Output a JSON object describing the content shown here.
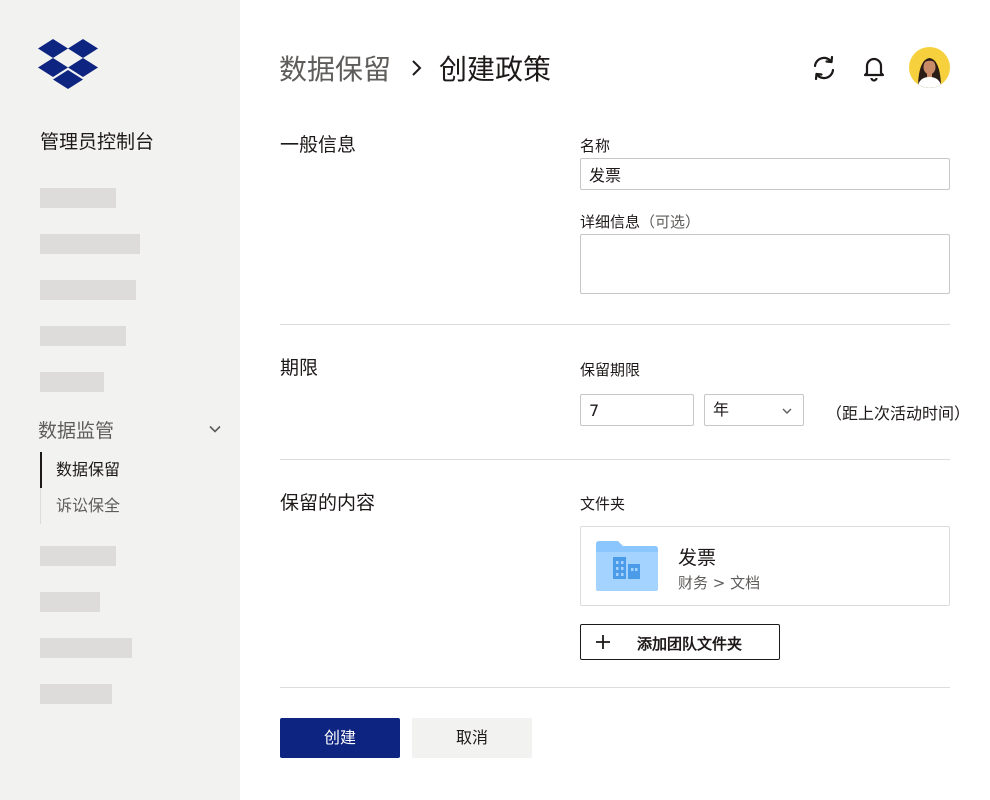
{
  "sidebar": {
    "console_title": "管理员控制台",
    "nav_group": {
      "label": "数据监管",
      "icon": "chevron-down-icon"
    },
    "sub_items": [
      {
        "label": "数据保留",
        "active": true
      },
      {
        "label": "诉讼保全",
        "active": false
      }
    ]
  },
  "header": {
    "breadcrumb_parent": "数据保留",
    "breadcrumb_current": "创建政策",
    "icons": [
      "sync-icon",
      "bell-icon",
      "avatar"
    ]
  },
  "form": {
    "general": {
      "title": "一般信息",
      "name_label": "名称",
      "name_value": "发票",
      "details_label": "详细信息",
      "details_optional": "（可选）",
      "details_value": ""
    },
    "period": {
      "title": "期限",
      "retention_label": "保留期限",
      "retention_value": "7",
      "unit_value": "年",
      "after_text": "（距上次活动时间）"
    },
    "content": {
      "title": "保留的内容",
      "folder_label": "文件夹",
      "folder": {
        "name": "发票",
        "path": "财务 > 文档"
      },
      "add_button": "添加团队文件夹"
    }
  },
  "actions": {
    "create": "创建",
    "cancel": "取消"
  },
  "colors": {
    "primary": "#0d2481",
    "sidebar_bg": "#f2f2f1",
    "placeholder": "#dddcdb",
    "folder_blue": "#8cc6ff",
    "avatar_bg": "#f7d13d"
  }
}
